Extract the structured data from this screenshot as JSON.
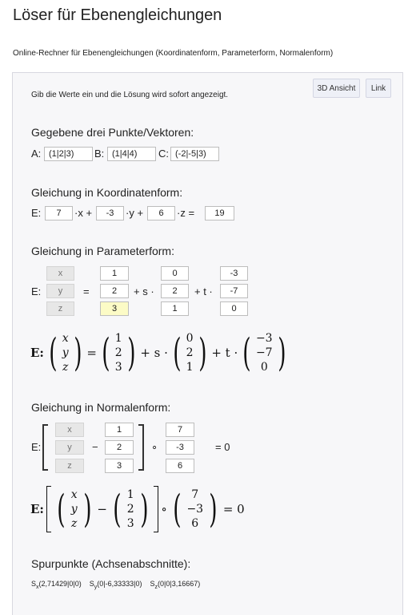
{
  "page": {
    "title": "Löser für Ebenengleichungen",
    "subtitle": "Online-Rechner für Ebenengleichungen (Koordinatenform, Parameterform, Normalenform)"
  },
  "toolbar": {
    "view3d_label": "3D Ansicht",
    "link_label": "Link"
  },
  "intro": "Gib die Werte ein und die Lösung wird sofort angezeigt.",
  "points": {
    "heading": "Gegebene drei Punkte/Vektoren:",
    "a_label": "A:",
    "a_value": "(1|2|3)",
    "b_label": "B:",
    "b_value": "(1|4|4)",
    "c_label": "C:",
    "c_value": "(-2|-5|3)"
  },
  "coordinate_form": {
    "heading": "Gleichung in Koordinatenform:",
    "e_label": "E:",
    "a": "7",
    "x_term": "·x +",
    "b": "-3",
    "y_term": "·y +",
    "c": "6",
    "z_term": "·z =",
    "d": "19"
  },
  "parameter_form": {
    "heading": "Gleichung in Parameterform:",
    "e_label": "E:",
    "var_placeholders": [
      "x",
      "y",
      "z"
    ],
    "equals": "=",
    "s_term": "+ s ·",
    "t_term": "+ t ·",
    "support": [
      "1",
      "2",
      "3"
    ],
    "dir_s": [
      "0",
      "2",
      "1"
    ],
    "dir_t": [
      "-3",
      "-7",
      "0"
    ],
    "tex": {
      "e_label": "E:",
      "vars": [
        "x",
        "y",
        "z"
      ],
      "equals": "=",
      "support": [
        "1",
        "2",
        "3"
      ],
      "s_term": "+ s ·",
      "dir_s": [
        "0",
        "2",
        "1"
      ],
      "t_term": "+ t ·",
      "dir_t": [
        "−3",
        "−7",
        "0"
      ]
    }
  },
  "normal_form": {
    "heading": "Gleichung in Normalenform:",
    "e_label": "E:",
    "var_placeholders": [
      "x",
      "y",
      "z"
    ],
    "minus": "−",
    "dot": "∘",
    "equals_zero": "= 0",
    "support": [
      "1",
      "2",
      "3"
    ],
    "normal": [
      "7",
      "-3",
      "6"
    ],
    "tex": {
      "e_label": "E:",
      "vars": [
        "x",
        "y",
        "z"
      ],
      "minus": "−",
      "support": [
        "1",
        "2",
        "3"
      ],
      "dot": "∘",
      "normal": [
        "7",
        "−3",
        "6"
      ],
      "equals_zero": "= 0"
    }
  },
  "trace_points": {
    "heading": "Spurpunkte (Achsenabschnitte):",
    "sx_sub": "x",
    "sx_value": "(2,71429|0|0)",
    "sy_sub": "y",
    "sy_value": "(0|-6,33333|0)",
    "sz_sub": "z",
    "sz_value": "(0|0|3,16667)"
  }
}
